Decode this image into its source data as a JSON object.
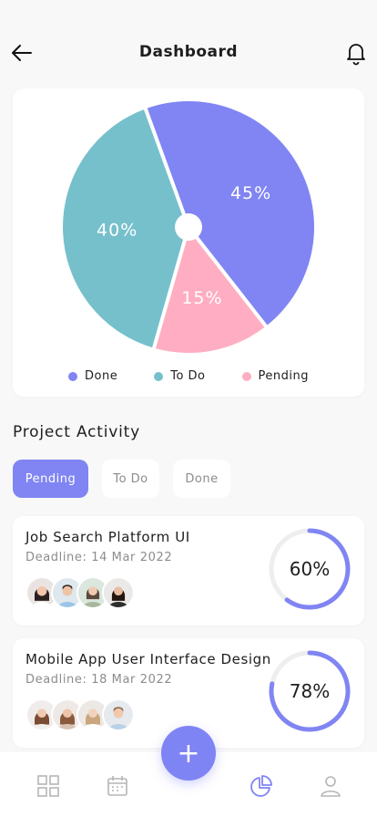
{
  "header": {
    "title": "Dashboard",
    "back_icon": "arrow-left-icon",
    "bell_icon": "bell-icon"
  },
  "chart_data": {
    "type": "pie",
    "title": "",
    "slices": [
      {
        "label": "Done",
        "value": 45,
        "label_text": "45%",
        "color": "#8085f3"
      },
      {
        "label": "Pending",
        "value": 15,
        "label_text": "15%",
        "color": "#ffadc2"
      },
      {
        "label": "To Do",
        "value": 40,
        "label_text": "40%",
        "color": "#76c0cc"
      }
    ],
    "legend": [
      {
        "label": "Done",
        "color": "#8085f3"
      },
      {
        "label": "To Do",
        "color": "#76c0cc"
      },
      {
        "label": "Pending",
        "color": "#ffadc2"
      }
    ],
    "legend_position": "bottom"
  },
  "activity": {
    "title": "Project Activity",
    "tabs": [
      {
        "label": "Pending",
        "active": true
      },
      {
        "label": "To Do",
        "active": false
      },
      {
        "label": "Done",
        "active": false
      }
    ]
  },
  "tasks": [
    {
      "title": "Job Search Platform UI",
      "deadline": "Deadline: 14 Mar 2022",
      "progress": 60,
      "progress_text": "60%"
    },
    {
      "title": "Mobile App User Interface Design",
      "deadline": "Deadline: 18 Mar 2022",
      "progress": 78,
      "progress_text": "78%"
    }
  ],
  "colors": {
    "accent": "#8085f3",
    "ring_track": "#eeeeee"
  },
  "fab": {
    "label": "+"
  },
  "bottom_nav": [
    "grid-icon",
    "calendar-icon",
    "pie-chart-icon",
    "user-icon"
  ]
}
